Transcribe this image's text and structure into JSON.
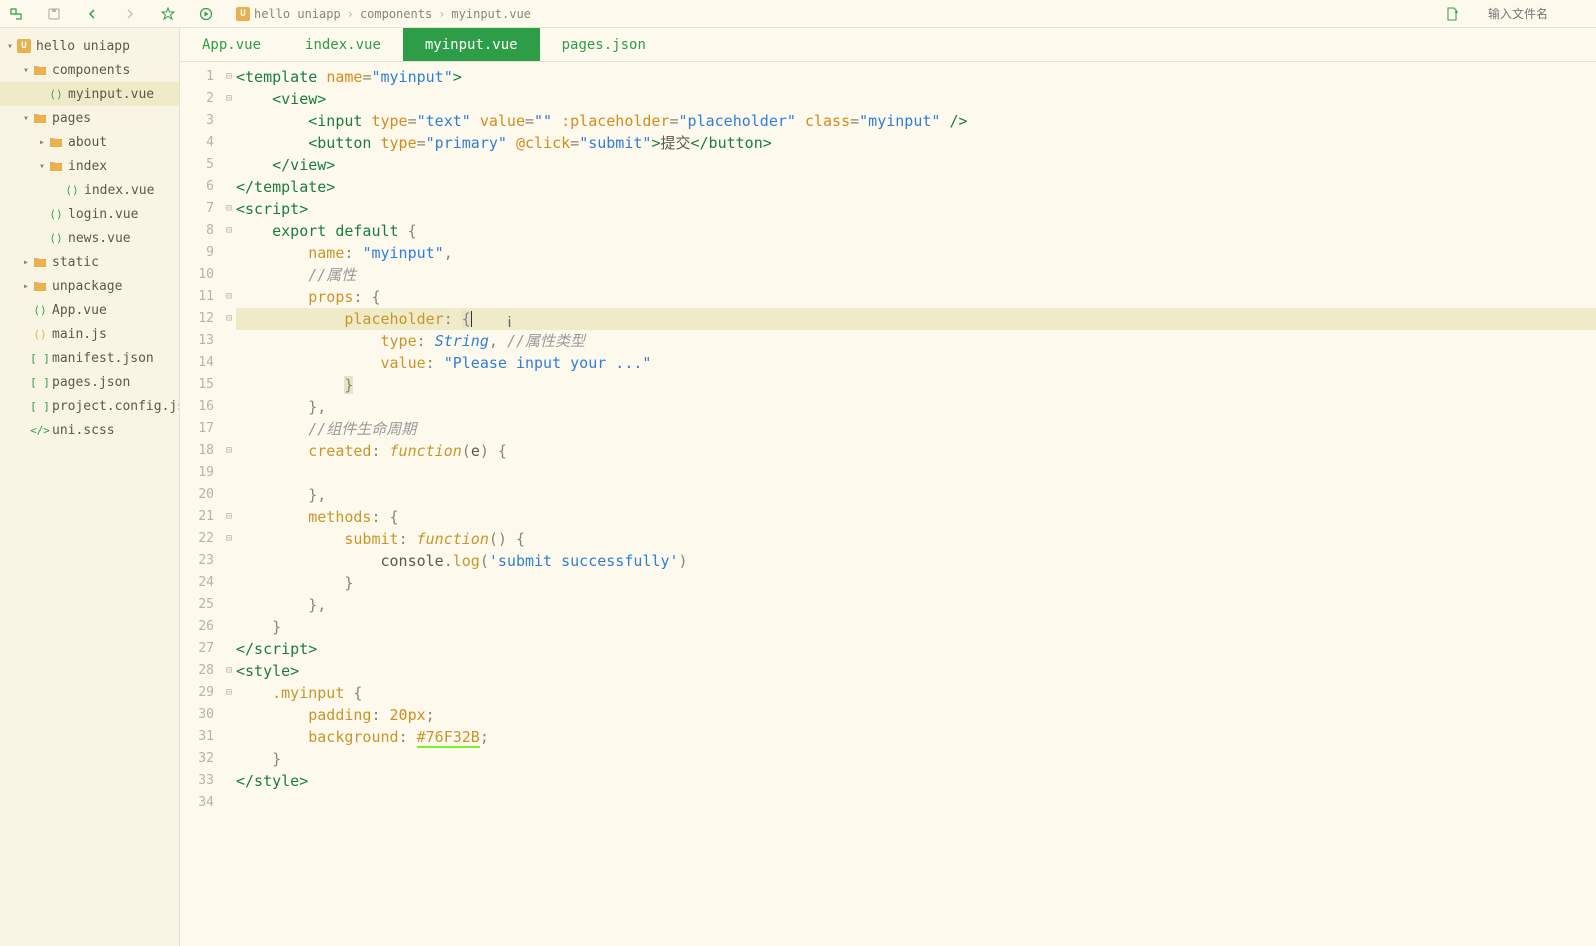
{
  "toolbar": {
    "search_placeholder": "输入文件名"
  },
  "breadcrumb": {
    "project": "hello uniapp",
    "mid": "components",
    "file": "myinput.vue"
  },
  "sidebar": {
    "project": "hello uniapp",
    "components": "components",
    "myinput": "myinput.vue",
    "pages": "pages",
    "about": "about",
    "index": "index",
    "index_vue": "index.vue",
    "login": "login.vue",
    "news": "news.vue",
    "static": "static",
    "unpackage": "unpackage",
    "app_vue": "App.vue",
    "main_js": "main.js",
    "manifest": "manifest.json",
    "pages_json": "pages.json",
    "proj_cfg": "project.config.json",
    "uni_scss": "uni.scss"
  },
  "tabs": [
    "App.vue",
    "index.vue",
    "myinput.vue",
    "pages.json"
  ],
  "code": {
    "l1": "<template name=\"myinput\">",
    "l2": "    <view>",
    "l3": "        <input type=\"text\" value=\"\" :placeholder=\"placeholder\" class=\"myinput\" />",
    "l4": "        <button type=\"primary\" @click=\"submit\">提交</button>",
    "l5": "    </view>",
    "l6": "</template>",
    "l7": "<script>",
    "l8": "    export default {",
    "l9": "        name: \"myinput\",",
    "l10": "        //属性",
    "l11": "        props: {",
    "l12": "            placeholder: {",
    "l13": "                type: String, //属性类型",
    "l14": "                value: \"Please input your ...\"",
    "l15": "            }",
    "l16": "        },",
    "l17": "        //组件生命周期",
    "l18": "        created: function(e) {",
    "l19": "",
    "l20": "        },",
    "l21": "        methods: {",
    "l22": "            submit: function() {",
    "l23": "                console.log('submit successfully')",
    "l24": "            }",
    "l25": "        },",
    "l26": "    }",
    "l27": "</script>",
    "l28": "<style>",
    "l29": "    .myinput {",
    "l30": "        padding: 20px;",
    "l31": "        background: #76F32B;",
    "l32": "    }",
    "l33": "</style>"
  }
}
